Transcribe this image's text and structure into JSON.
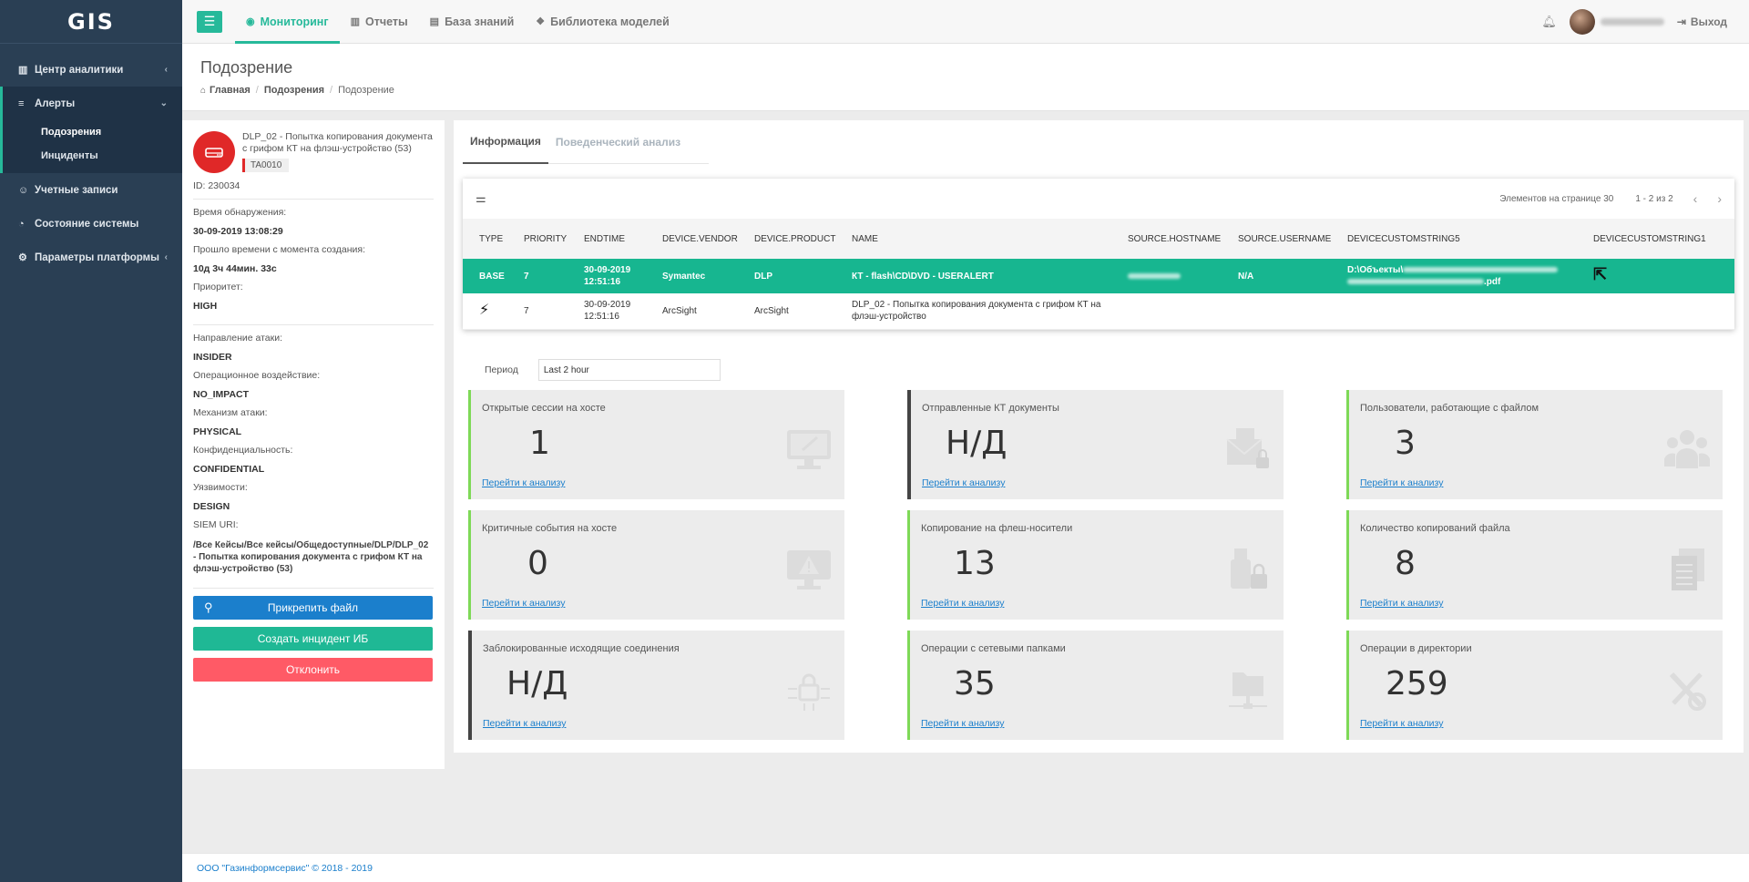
{
  "app": {
    "logo": "GIS"
  },
  "sidebar": {
    "items": [
      {
        "label": "Центр аналитики",
        "chevron": "‹"
      },
      {
        "label": "Алерты",
        "chevron": "⌄",
        "sub": [
          "Подозрения",
          "Инциденты"
        ]
      },
      {
        "label": "Учетные записи"
      },
      {
        "label": "Состояние системы"
      },
      {
        "label": "Параметры платформы",
        "chevron": "‹"
      }
    ]
  },
  "topbar": {
    "tabs": [
      "Мониторинг",
      "Отчеты",
      "База знаний",
      "Библиотека моделей"
    ],
    "logout": "Выход"
  },
  "page": {
    "title": "Подозрение",
    "breadcrumb": [
      "Главная",
      "Подозрения",
      "Подозрение"
    ]
  },
  "alert": {
    "name": "DLP_02 - Попытка копирования документа с грифом КТ на флэш-устройство (53)",
    "tag": "TA0010",
    "id": "ID: 230034",
    "fields": [
      {
        "label": "Время обнаружения:",
        "value": "30-09-2019 13:08:29"
      },
      {
        "label": "Прошло времени с момента создания:",
        "value": "10д 3ч 44мин. 33с"
      },
      {
        "label": "Приоритет:",
        "value": "HIGH"
      }
    ],
    "fields2": [
      {
        "label": "Направление атаки:",
        "value": "INSIDER"
      },
      {
        "label": "Операционное воздействие:",
        "value": "NO_IMPACT"
      },
      {
        "label": "Механизм атаки:",
        "value": "PHYSICAL"
      },
      {
        "label": "Конфиденциальность:",
        "value": "CONFIDENTIAL"
      },
      {
        "label": "Уязвимости:",
        "value": "DESIGN"
      }
    ],
    "siem_label": "SIEM URI:",
    "siem_value": "/Все Кейсы/Все кейсы/Общедоступные/DLP/DLP_02 - Попытка копирования документа с грифом КТ на флэш-устройство (53)",
    "buttons": {
      "attach": "Прикрепить файл",
      "create": "Создать инцидент ИБ",
      "reject": "Отклонить"
    }
  },
  "tabs": [
    "Информация",
    "Поведенческий анализ"
  ],
  "grid": {
    "per_page_label": "Элементов на странице 30",
    "range": "1 - 2 из 2",
    "columns": [
      "TYPE",
      "PRIORITY",
      "ENDTIME",
      "DEVICE.VENDOR",
      "DEVICE.PRODUCT",
      "NAME",
      "SOURCE.HOSTNAME",
      "SOURCE.USERNAME",
      "DEVICECUSTOMSTRING5",
      "DEVICECUSTOMSTRING1"
    ],
    "rows": [
      {
        "type": "BASE",
        "priority": "7",
        "endtime_date": "30-09-2019",
        "endtime_time": "12:51:16",
        "vendor": "Symantec",
        "product": "DLP",
        "name": "КТ - flash\\CD\\DVD - USERALERT",
        "username": "N/A",
        "dcs5_prefix": "D:\\Объекты\\",
        "dcs5_suffix": ".pdf"
      },
      {
        "type": "",
        "priority": "7",
        "endtime_date": "30-09-2019",
        "endtime_time": "12:51:16",
        "vendor": "ArcSight",
        "product": "ArcSight",
        "name": "DLP_02 - Попытка копирования документа с грифом КТ на флэш-устройство",
        "username": "",
        "dcs5_prefix": "",
        "dcs5_suffix": ""
      }
    ]
  },
  "period": {
    "label": "Период",
    "value": "Last 2 hour"
  },
  "stats": [
    {
      "title": "Открытые сессии на хосте",
      "value": "1",
      "link": "Перейти к анализу",
      "icon": "monitor-icon"
    },
    {
      "title": "Отправленные КТ документы",
      "value": "Н/Д",
      "link": "Перейти к анализу",
      "icon": "mail-lock-icon"
    },
    {
      "title": "Пользователи, работающие с файлом",
      "value": "3",
      "link": "Перейти к анализу",
      "icon": "users-icon"
    },
    {
      "title": "Критичные события на хосте",
      "value": "0",
      "link": "Перейти к анализу",
      "icon": "monitor-warning-icon"
    },
    {
      "title": "Копирование на флеш-носители",
      "value": "13",
      "link": "Перейти к анализу",
      "icon": "usb-lock-icon"
    },
    {
      "title": "Количество копирований файла",
      "value": "8",
      "link": "Перейти к анализу",
      "icon": "copy-files-icon"
    },
    {
      "title": "Заблокированные исходящие соединения",
      "value": "Н/Д",
      "link": "Перейти к анализу",
      "icon": "network-lock-icon"
    },
    {
      "title": "Операции с сетевыми папками",
      "value": "35",
      "link": "Перейти к анализу",
      "icon": "network-folder-icon"
    },
    {
      "title": "Операции в директории",
      "value": "259",
      "link": "Перейти к анализу",
      "icon": "tools-icon"
    }
  ],
  "footer": {
    "text": "ООО \"Газинформсервис\" © 2018 - 2019"
  },
  "colors": {
    "accent": "#26b99a",
    "sidebar": "#2a3f54",
    "danger": "#e02828",
    "link": "#1b7fcc"
  }
}
